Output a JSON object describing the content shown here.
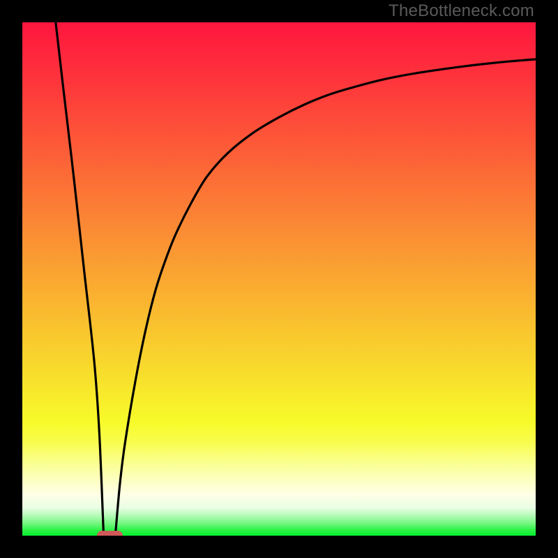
{
  "watermark": "TheBottleneck.com",
  "colors": {
    "black": "#000000",
    "curve": "#000000",
    "marker": "#cf5a58",
    "gradient_stops": [
      {
        "pos": 0.0,
        "hex": "#fe163e"
      },
      {
        "pos": 0.1,
        "hex": "#fe313c"
      },
      {
        "pos": 0.2,
        "hex": "#fd4e39"
      },
      {
        "pos": 0.3,
        "hex": "#fc6c36"
      },
      {
        "pos": 0.4,
        "hex": "#fb8a34"
      },
      {
        "pos": 0.5,
        "hex": "#faa731"
      },
      {
        "pos": 0.6,
        "hex": "#f9c52e"
      },
      {
        "pos": 0.7,
        "hex": "#f8e22c"
      },
      {
        "pos": 0.78,
        "hex": "#f7fb2a"
      },
      {
        "pos": 0.815,
        "hex": "#f8fd4a"
      },
      {
        "pos": 0.85,
        "hex": "#faff83"
      },
      {
        "pos": 0.885,
        "hex": "#fcffb8"
      },
      {
        "pos": 0.92,
        "hex": "#feffe6"
      },
      {
        "pos": 0.945,
        "hex": "#eafee4"
      },
      {
        "pos": 0.96,
        "hex": "#b8fbba"
      },
      {
        "pos": 0.975,
        "hex": "#79f784"
      },
      {
        "pos": 0.99,
        "hex": "#28f244"
      },
      {
        "pos": 1.0,
        "hex": "#06f030"
      }
    ]
  },
  "chart_data": {
    "type": "line",
    "title": "",
    "xlabel": "",
    "ylabel": "",
    "xlim": [
      0,
      100
    ],
    "ylim": [
      0,
      100
    ],
    "grid": false,
    "series": [
      {
        "name": "left-branch",
        "x": [
          6.5,
          8,
          10,
          12,
          14,
          15,
          15.8
        ],
        "y": [
          100,
          87,
          70,
          52,
          34,
          20,
          1
        ]
      },
      {
        "name": "right-branch",
        "x": [
          18.2,
          19,
          20,
          22,
          24,
          26,
          28,
          30,
          33,
          36,
          40,
          45,
          50,
          55,
          60,
          65,
          70,
          75,
          80,
          85,
          90,
          95,
          100
        ],
        "y": [
          1,
          10,
          18,
          30,
          40,
          48,
          54,
          59,
          65,
          70,
          74.5,
          78.5,
          81.5,
          84,
          86,
          87.5,
          88.8,
          89.8,
          90.6,
          91.3,
          91.9,
          92.4,
          92.8
        ]
      }
    ],
    "marker": {
      "x_start": 14.5,
      "x_end": 19.5,
      "y": 0
    }
  }
}
